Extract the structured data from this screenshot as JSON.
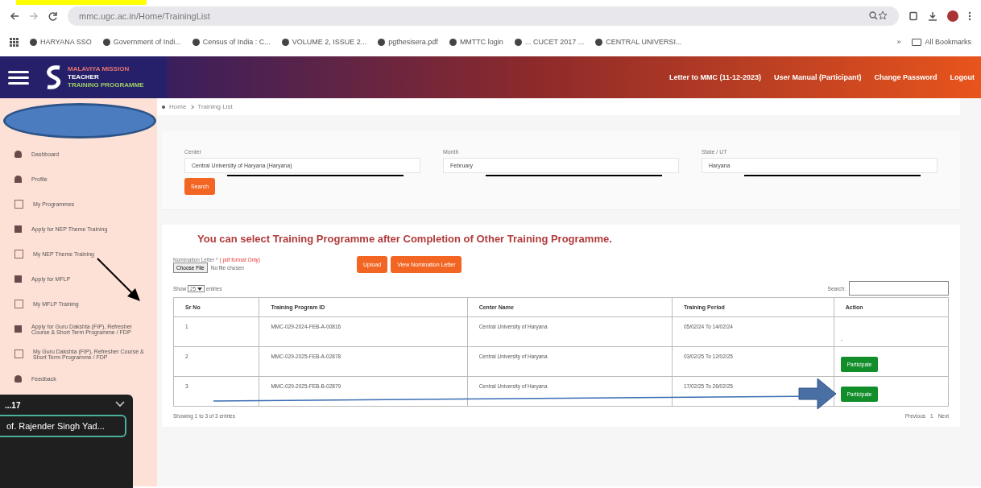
{
  "browser": {
    "url": "mmc.ugc.ac.in/Home/TrainingList",
    "bookmarks": [
      "HARYANA SSO",
      "Government of Indi...",
      "Census of India : C...",
      "VOLUME 2, ISSUE 2...",
      "pgthesisera.pdf",
      "MMTTC login",
      "... CUCET 2017 ...",
      "CENTRAL UNIVERSI..."
    ],
    "more": "»",
    "all_bookmarks": "All Bookmarks"
  },
  "header": {
    "logo_lines": [
      "MALAVIYA MISSION",
      "TEACHER",
      "TRAINING PROGRAMME"
    ],
    "links": [
      "Letter to MMC (11-12-2023)",
      "User Manual (Participant)",
      "Change Password",
      "Logout"
    ]
  },
  "sidebar": {
    "items": [
      {
        "label": "Dashboard",
        "kind": "home"
      },
      {
        "label": "Profile",
        "kind": "user"
      },
      {
        "label": "My Programmes",
        "kind": "list"
      },
      {
        "label": "Apply for NEP Theme Training",
        "kind": "form"
      },
      {
        "label": "My NEP Theme Training",
        "kind": "list"
      },
      {
        "label": "Apply for MFLP",
        "kind": "form"
      },
      {
        "label": "My MFLP Training",
        "kind": "list"
      },
      {
        "label": "Apply for Guru Dakshta (FIP), Refresher Course & Short Term Programme / FDP",
        "kind": "form"
      },
      {
        "label": "My Guru Dakshta (FIP), Refresher Course & Short Term Programme / FDP",
        "kind": "list"
      },
      {
        "label": "Feedback",
        "kind": "chat"
      }
    ]
  },
  "popup": {
    "title": "...17",
    "name": "of. Rajender Singh Yad..."
  },
  "breadcrumb": [
    "Home",
    "Training List"
  ],
  "filters": [
    {
      "label": "Center",
      "value": "Central University of Haryana (Haryana)"
    },
    {
      "label": "Month",
      "value": "February"
    },
    {
      "label": "State / UT",
      "value": "Haryana"
    }
  ],
  "search_button": "Search",
  "notice": "You can select Training Programme after Completion of Other Training Programme.",
  "upload": {
    "label": "Nomination Letter *",
    "hint": "( pdf format Only)",
    "choose": "Choose File",
    "no_file": "No file chosen",
    "upload_button": "Upload",
    "view_button": "View Nomination Letter"
  },
  "table": {
    "show": "Show",
    "page_size": "25",
    "entries": "entries",
    "search_label": "Search:",
    "columns": [
      "Sr No",
      "Training Program ID",
      "Center Name",
      "Training Period",
      "Action"
    ],
    "rows": [
      {
        "cells": [
          "1",
          "MMC-029-2024-FEB-A-00816",
          "Central University of Haryana",
          "05/02/24 To 14/02/24"
        ],
        "action": "-",
        "kind": "text"
      },
      {
        "cells": [
          "2",
          "MMC-029-2025-FEB-A-02878",
          "Central University of Haryana",
          "03/02/25 To 12/02/25"
        ],
        "action": "Participate",
        "kind": "button"
      },
      {
        "cells": [
          "3",
          "MMC-029-2025-FEB-B-02879",
          "Central University of Haryana",
          "17/02/25 To 26/02/25"
        ],
        "action": "Participate",
        "kind": "button"
      }
    ],
    "info": "Showing 1 to 3 of 3 entries",
    "pager": [
      "Previous",
      "1",
      "Next"
    ]
  }
}
